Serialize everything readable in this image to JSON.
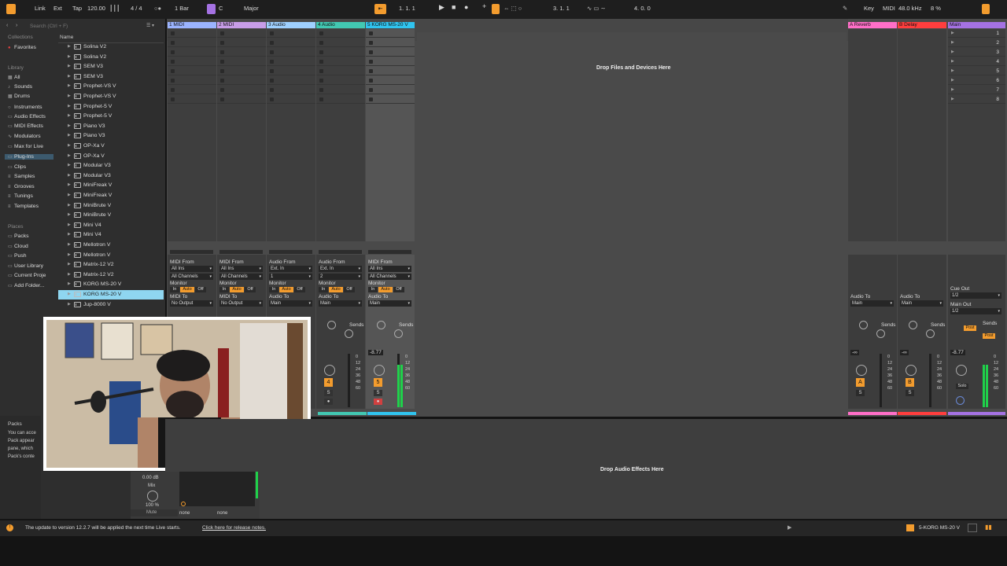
{
  "topbar": {
    "link": "Link",
    "ext": "Ext",
    "tap": "Tap",
    "tempo": "120.00",
    "signature": "4 / 4",
    "quantize": "1 Bar",
    "key": "C",
    "scale": "Major",
    "position": "1.   1.   1",
    "loop_start": "3.   1.   1",
    "loop_length": "4.   0.   0",
    "key_map": "Key",
    "midi_map": "MIDI",
    "sample_rate": "48.0 kHz",
    "cpu": "8 %"
  },
  "browser": {
    "search_placeholder": "Search (Ctrl + F)",
    "name_header": "Name",
    "collections_label": "Collections",
    "favorites": "Favorites",
    "library_label": "Library",
    "library": [
      "All",
      "Sounds",
      "Drums",
      "Instruments",
      "Audio Effects",
      "MIDI Effects",
      "Modulators",
      "Max for Live",
      "Plug-Ins",
      "Clips",
      "Samples",
      "Grooves",
      "Tunings",
      "Templates"
    ],
    "places_label": "Places",
    "places": [
      "Packs",
      "Cloud",
      "Push",
      "User Library",
      "Current Proje",
      "Add Folder..."
    ],
    "items": [
      "Solina V2",
      "Solina V2",
      "SEM V3",
      "SEM V3",
      "Prophet-VS V",
      "Prophet-VS V",
      "Prophet-5 V",
      "Prophet-5 V",
      "Piano V3",
      "Piano V3",
      "OP-Xa V",
      "OP-Xa V",
      "Modular V3",
      "Modular V3",
      "MiniFreak V",
      "MiniFreak V",
      "MiniBrute V",
      "MiniBrute V",
      "Mini V4",
      "Mini V4",
      "Mellotron V",
      "Mellotron V",
      "Matrix-12 V2",
      "Matrix-12 V2",
      "KORG MS-20 V",
      "KORG MS-20 V",
      "Jup-8000 V"
    ],
    "selected_index": 25,
    "info_title": "Packs",
    "info_lines": [
      "You can acce",
      "Pack appear",
      "pane, which ",
      "Pack's conte"
    ]
  },
  "tracks": [
    {
      "name": "1 MIDI",
      "color": "#9bb4ff",
      "input_type": "MIDI From",
      "input": "All Ins",
      "channel": "All Channels",
      "output_label": "MIDI To",
      "output": "No Output",
      "number": "",
      "monitor": "In"
    },
    {
      "name": "2 MIDI",
      "color": "#c89de8",
      "input_type": "MIDI From",
      "input": "All Ins",
      "channel": "All Channels",
      "output_label": "MIDI To",
      "output": "No Output",
      "number": "",
      "monitor": "In"
    },
    {
      "name": "3 Audio",
      "color": "#9fd0ff",
      "input_type": "Audio From",
      "input": "Ext. In",
      "channel": "1",
      "output_label": "Audio To",
      "output": "Main",
      "number": "",
      "monitor": "In"
    },
    {
      "name": "4 Audio",
      "color": "#42c8b2",
      "input_type": "Audio From",
      "input": "Ext. In",
      "channel": "2",
      "output_label": "Audio To",
      "output": "Main",
      "number": "4",
      "monitor": "In"
    },
    {
      "name": "5 KORG MS-20 V",
      "color": "#30c4ef",
      "input_type": "MIDI From",
      "input": "All Ins",
      "channel": "All Channels",
      "output_label": "Audio To",
      "output": "Main",
      "number": "5",
      "monitor": "In",
      "volume": "-8.77"
    }
  ],
  "monitor_labels": {
    "title": "Monitor",
    "in": "In",
    "auto": "Auto",
    "off": "Off"
  },
  "sends_label": "Sends",
  "returns": [
    {
      "name": "A Reverb",
      "color": "#ff6fc8",
      "letter": "A",
      "output_label": "Audio To",
      "output": "Main",
      "volume": "-∞"
    },
    {
      "name": "B Delay",
      "color": "#ff3e3e",
      "letter": "B",
      "output_label": "Audio To",
      "output": "Main",
      "volume": "-∞"
    }
  ],
  "main": {
    "name": "Main",
    "color": "#a572e3",
    "cue_label": "Cue Out",
    "cue": "1/2",
    "out_label": "Main Out",
    "out": "1/2",
    "volume": "-8.77",
    "scenes": [
      "1",
      "2",
      "3",
      "4",
      "5",
      "6",
      "7",
      "8"
    ],
    "post": "Post",
    "solo": "Solo"
  },
  "meter_scale": [
    "0",
    "12",
    "24",
    "36",
    "48",
    "60"
  ],
  "drop_files": "Drop Files and Devices Here",
  "drop_effects": "Drop Audio Effects Here",
  "detail": {
    "gain": "0.00 dB",
    "mix_label": "Mix",
    "mix_value": "100 %",
    "mute": "Mute",
    "none1": "none",
    "none2": "none"
  },
  "status": {
    "message": "The update to version 12.2.7 will be applied the next time Live starts.",
    "link": "Click here for release notes.",
    "current_track": "5-KORG MS-20 V"
  }
}
